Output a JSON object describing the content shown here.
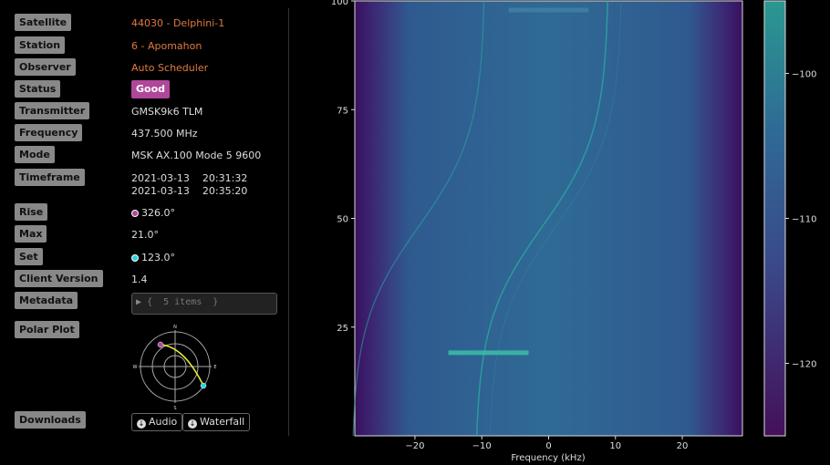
{
  "labels": {
    "satellite": "Satellite",
    "station": "Station",
    "observer": "Observer",
    "status": "Status",
    "transmitter": "Transmitter",
    "frequency": "Frequency",
    "mode": "Mode",
    "timeframe": "Timeframe",
    "rise": "Rise",
    "max": "Max",
    "set": "Set",
    "client_version": "Client Version",
    "metadata": "Metadata",
    "polar_plot": "Polar Plot",
    "downloads": "Downloads"
  },
  "values": {
    "satellite": "44030 - Delphini-1",
    "station": "6 - Apomahon",
    "observer": "Auto Scheduler",
    "status": "Good",
    "transmitter": "GMSK9k6 TLM",
    "frequency": "437.500 MHz",
    "mode": "MSK AX.100 Mode 5 9600",
    "timeframe_start": "2021-03-13    20:31:32",
    "timeframe_end": "2021-03-13    20:35:20",
    "rise": "326.0°",
    "max": "21.0°",
    "set": "123.0°",
    "client_version": "1.4",
    "metadata": "{  5 items  }"
  },
  "polar": {
    "n": "N",
    "e": "E",
    "s": "S",
    "w": "W"
  },
  "downloads": {
    "audio": "Audio",
    "waterfall": "Waterfall"
  },
  "colors": {
    "status_good": "#b0479a",
    "rise_dot": "#b0479a",
    "set_dot": "#2ad4e0",
    "link": "#e07a3f"
  },
  "chart_data": {
    "type": "heatmap",
    "xlabel": "Frequency (kHz)",
    "ylabel": "",
    "x_ticks": [
      -20,
      -10,
      0,
      10,
      20
    ],
    "y_ticks": [
      25,
      50,
      75,
      100
    ],
    "xlim": [
      -29,
      29
    ],
    "ylim": [
      0,
      100
    ],
    "colorbar_ticks": [
      -100,
      -110,
      -120
    ],
    "colorbar_labels": [
      "−100",
      "−110",
      "−120"
    ],
    "x_tick_labels": [
      "−20",
      "−10",
      "0",
      "10",
      "20"
    ],
    "y_tick_labels": [
      "25",
      "50",
      "75",
      "100"
    ]
  }
}
